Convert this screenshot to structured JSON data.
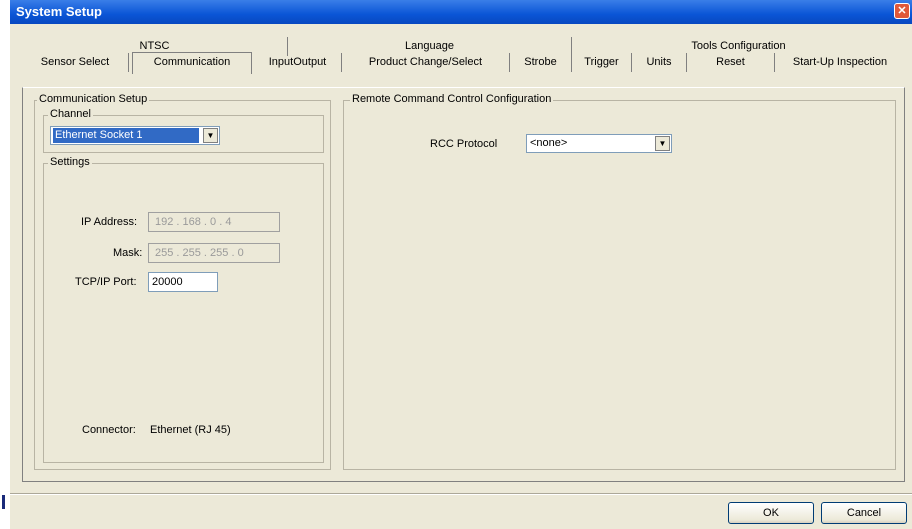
{
  "window": {
    "title": "System  Setup",
    "close_glyph": "✕"
  },
  "tabs_top": [
    {
      "label": "NTSC"
    },
    {
      "label": "Language"
    },
    {
      "label": "Tools Configuration"
    }
  ],
  "tabs_bottom": [
    {
      "label": "Sensor Select"
    },
    {
      "label": "Communication"
    },
    {
      "label": "InputOutput"
    },
    {
      "label": "Product Change/Select"
    },
    {
      "label": "Strobe"
    },
    {
      "label": "Trigger"
    },
    {
      "label": "Units"
    },
    {
      "label": "Reset"
    },
    {
      "label": "Start-Up Inspection"
    }
  ],
  "active_tab": "Communication",
  "comm_setup": {
    "title": "Communication Setup",
    "channel": {
      "title": "Channel",
      "value": "Ethernet Socket 1"
    },
    "settings": {
      "title": "Settings",
      "ip_label": "IP Address:",
      "ip_value": "192 . 168 .  0  .  4",
      "mask_label": "Mask:",
      "mask_value": "255 . 255 . 255 .  0",
      "port_label": "TCP/IP Port:",
      "port_value": "20000",
      "connector_label": "Connector:",
      "connector_value": "Ethernet (RJ 45)"
    }
  },
  "rcc": {
    "title": "Remote Command Control Configuration",
    "protocol_label": "RCC Protocol",
    "protocol_value": "<none>"
  },
  "buttons": {
    "ok": "OK",
    "cancel": "Cancel"
  },
  "icons": {
    "dropdown": "chevron-down-icon",
    "close": "close-icon"
  },
  "colors": {
    "titlebar": "#0a55d6",
    "selection": "#316ac5",
    "window_bg": "#ece9d8"
  }
}
